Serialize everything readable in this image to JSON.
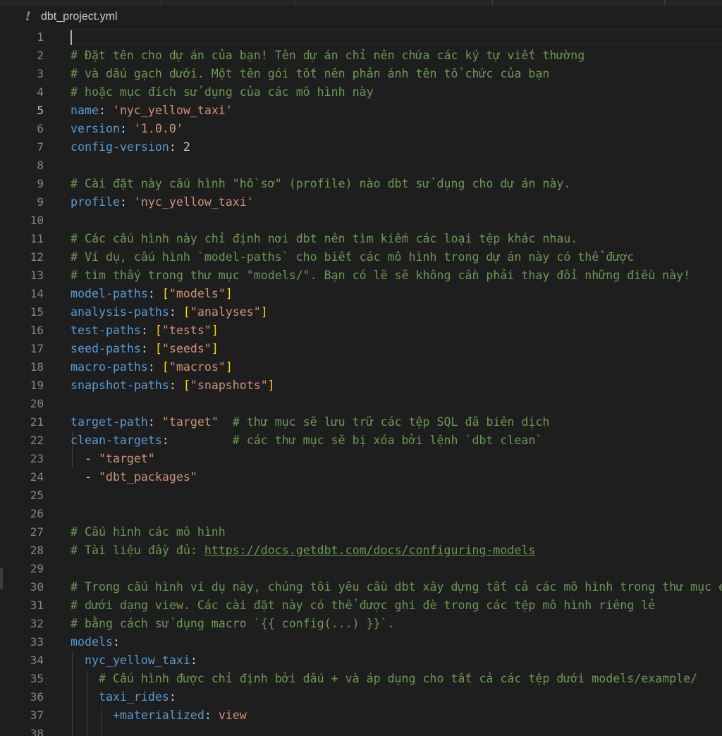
{
  "breadcrumb": {
    "file_icon": "!",
    "file_name": "dbt_project.yml"
  },
  "lines": [
    {
      "n": "1",
      "parts": []
    },
    {
      "n": "2",
      "parts": [
        {
          "t": "c",
          "v": "# Đặt tên cho dự án của bạn! Tên dự án chỉ nên chứa các ký tự viết thường"
        }
      ]
    },
    {
      "n": "3",
      "parts": [
        {
          "t": "c",
          "v": "# và dấu gạch dưới. Một tên gói tốt nên phản ánh tên tổ chức của bạn"
        }
      ]
    },
    {
      "n": "4",
      "parts": [
        {
          "t": "c",
          "v": "# hoặc mục đích sử dụng của các mô hình này"
        }
      ]
    },
    {
      "n": "5",
      "parts": [
        {
          "t": "k",
          "v": "name"
        },
        {
          "t": "p",
          "v": ": "
        },
        {
          "t": "s",
          "v": "'nyc_yellow_taxi'"
        }
      ]
    },
    {
      "n": "6",
      "parts": [
        {
          "t": "k",
          "v": "version"
        },
        {
          "t": "p",
          "v": ": "
        },
        {
          "t": "s",
          "v": "'1.0.0'"
        }
      ]
    },
    {
      "n": "7",
      "parts": [
        {
          "t": "k",
          "v": "config-version"
        },
        {
          "t": "p",
          "v": ": "
        },
        {
          "t": "n",
          "v": "2"
        }
      ]
    },
    {
      "n": "8",
      "parts": []
    },
    {
      "n": "9",
      "parts": [
        {
          "t": "c",
          "v": "# Cài đặt này cấu hình \"hồ sơ\" (profile) nào dbt sử dụng cho dự án này."
        }
      ]
    },
    {
      "n": "9",
      "parts": [
        {
          "t": "k",
          "v": "profile"
        },
        {
          "t": "p",
          "v": ": "
        },
        {
          "t": "s",
          "v": "'nyc_yellow_taxi'"
        }
      ]
    },
    {
      "n": "10",
      "parts": []
    },
    {
      "n": "11",
      "parts": [
        {
          "t": "c",
          "v": "# Các cấu hình này chỉ định nơi dbt nên tìm kiếm các loại tệp khác nhau."
        }
      ]
    },
    {
      "n": "12",
      "parts": [
        {
          "t": "c",
          "v": "# Ví dụ, cấu hình `model-paths` cho biết các mô hình trong dự án này có thể được"
        }
      ]
    },
    {
      "n": "13",
      "parts": [
        {
          "t": "c",
          "v": "# tìm thấy trong thư mục \"models/\". Bạn có lẽ sẽ không cần phải thay đổi những điều này!"
        }
      ]
    },
    {
      "n": "14",
      "parts": [
        {
          "t": "k",
          "v": "model-paths"
        },
        {
          "t": "p",
          "v": ": "
        },
        {
          "t": "b",
          "v": "["
        },
        {
          "t": "s",
          "v": "\"models\""
        },
        {
          "t": "b",
          "v": "]"
        }
      ]
    },
    {
      "n": "15",
      "parts": [
        {
          "t": "k",
          "v": "analysis-paths"
        },
        {
          "t": "p",
          "v": ": "
        },
        {
          "t": "b",
          "v": "["
        },
        {
          "t": "s",
          "v": "\"analyses\""
        },
        {
          "t": "b",
          "v": "]"
        }
      ]
    },
    {
      "n": "16",
      "parts": [
        {
          "t": "k",
          "v": "test-paths"
        },
        {
          "t": "p",
          "v": ": "
        },
        {
          "t": "b",
          "v": "["
        },
        {
          "t": "s",
          "v": "\"tests\""
        },
        {
          "t": "b",
          "v": "]"
        }
      ]
    },
    {
      "n": "17",
      "parts": [
        {
          "t": "k",
          "v": "seed-paths"
        },
        {
          "t": "p",
          "v": ": "
        },
        {
          "t": "b",
          "v": "["
        },
        {
          "t": "s",
          "v": "\"seeds\""
        },
        {
          "t": "b",
          "v": "]"
        }
      ]
    },
    {
      "n": "18",
      "parts": [
        {
          "t": "k",
          "v": "macro-paths"
        },
        {
          "t": "p",
          "v": ": "
        },
        {
          "t": "b",
          "v": "["
        },
        {
          "t": "s",
          "v": "\"macros\""
        },
        {
          "t": "b",
          "v": "]"
        }
      ]
    },
    {
      "n": "19",
      "parts": [
        {
          "t": "k",
          "v": "snapshot-paths"
        },
        {
          "t": "p",
          "v": ": "
        },
        {
          "t": "b",
          "v": "["
        },
        {
          "t": "s",
          "v": "\"snapshots\""
        },
        {
          "t": "b",
          "v": "]"
        }
      ]
    },
    {
      "n": "20",
      "parts": []
    },
    {
      "n": "21",
      "parts": [
        {
          "t": "k",
          "v": "target-path"
        },
        {
          "t": "p",
          "v": ": "
        },
        {
          "t": "s",
          "v": "\"target\""
        },
        {
          "t": "p",
          "v": "  "
        },
        {
          "t": "c",
          "v": "# thư mục sẽ lưu trữ các tệp SQL đã biên dịch"
        }
      ]
    },
    {
      "n": "22",
      "parts": [
        {
          "t": "k",
          "v": "clean-targets"
        },
        {
          "t": "p",
          "v": ":         "
        },
        {
          "t": "c",
          "v": "# các thư mục sẽ bị xóa bởi lệnh `dbt clean`"
        }
      ]
    },
    {
      "n": "23",
      "parts": [
        {
          "t": "p",
          "v": "  - "
        },
        {
          "t": "s",
          "v": "\"target\""
        }
      ]
    },
    {
      "n": "24",
      "parts": [
        {
          "t": "p",
          "v": "  - "
        },
        {
          "t": "s",
          "v": "\"dbt_packages\""
        }
      ]
    },
    {
      "n": "25",
      "parts": []
    },
    {
      "n": "26",
      "parts": []
    },
    {
      "n": "27",
      "parts": [
        {
          "t": "c",
          "v": "# Cấu hình các mô hình"
        }
      ]
    },
    {
      "n": "28",
      "parts": [
        {
          "t": "c",
          "v": "# Tài liệu đầy đủ: "
        },
        {
          "t": "u",
          "v": "https://docs.getdbt.com/docs/configuring-models"
        }
      ]
    },
    {
      "n": "29",
      "parts": []
    },
    {
      "n": "30",
      "parts": [
        {
          "t": "c",
          "v": "# Trong cấu hình ví dụ này, chúng tôi yêu cầu dbt xây dựng tất cả các mô hình trong thư mục example/"
        }
      ]
    },
    {
      "n": "31",
      "parts": [
        {
          "t": "c",
          "v": "# dưới dạng view. Các cài đặt này có thể được ghi đè trong các tệp mô hình riêng lẻ"
        }
      ]
    },
    {
      "n": "32",
      "parts": [
        {
          "t": "c",
          "v": "# bằng cách sử dụng macro `{{ config(...) }}`."
        }
      ]
    },
    {
      "n": "33",
      "parts": [
        {
          "t": "k",
          "v": "models"
        },
        {
          "t": "p",
          "v": ":"
        }
      ]
    },
    {
      "n": "34",
      "parts": [
        {
          "t": "p",
          "v": "  "
        },
        {
          "t": "k",
          "v": "nyc_yellow_taxi"
        },
        {
          "t": "p",
          "v": ":"
        }
      ]
    },
    {
      "n": "35",
      "parts": [
        {
          "t": "p",
          "v": "    "
        },
        {
          "t": "c",
          "v": "# Cấu hình được chỉ định bởi dấu + và áp dụng cho tất cả các tệp dưới models/example/"
        }
      ]
    },
    {
      "n": "36",
      "parts": [
        {
          "t": "p",
          "v": "    "
        },
        {
          "t": "k",
          "v": "taxi_rides"
        },
        {
          "t": "p",
          "v": ":"
        }
      ]
    },
    {
      "n": "37",
      "parts": [
        {
          "t": "p",
          "v": "      "
        },
        {
          "t": "k",
          "v": "+materialized"
        },
        {
          "t": "p",
          "v": ": "
        },
        {
          "t": "s",
          "v": "view"
        }
      ]
    },
    {
      "n": "38",
      "parts": []
    }
  ],
  "active_line_index": 4,
  "colors": {
    "background": "#1e1e1e",
    "comment": "#6a9955",
    "key": "#569cd6",
    "string": "#ce9178",
    "number": "#b5cea8",
    "bracket": "#ffd700",
    "line_number": "#858585"
  }
}
